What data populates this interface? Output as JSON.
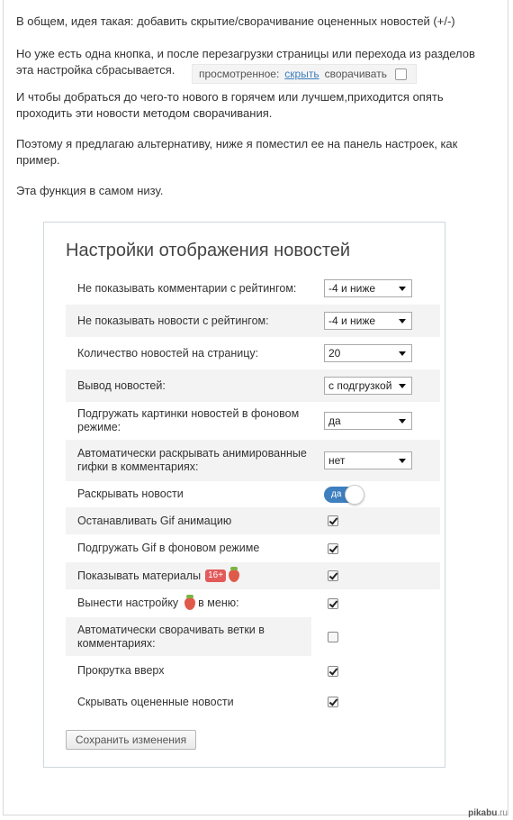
{
  "intro": {
    "p1": "В общем, идея такая: добавить скрытие/сворачивание оцененных новостей (+/-)",
    "p2": "Но уже есть одна кнопка, и после перезагрузки страницы  или перехода из разделов эта настройка сбрасывается.",
    "p3": "И чтобы добраться до чего-то нового в горячем или лучшем,приходится опять проходить эти новости методом сворачивания.",
    "p4": "Поэтому я предлагаю альтернативу, ниже я поместил ее на панель настроек, как пример.",
    "p5": "Эта функция в самом низу."
  },
  "mini_widget": {
    "label": "просмотренное:",
    "link": "скрыть",
    "toggle_label": "сворачивать"
  },
  "panel": {
    "title": "Настройки отображения новостей",
    "rows": {
      "hide_comments": {
        "label": "Не показывать комментарии с рейтингом:",
        "value": "-4 и ниже"
      },
      "hide_news": {
        "label": "Не показывать новости с рейтингом:",
        "value": "-4 и ниже"
      },
      "news_per_page": {
        "label": "Количество новостей на страницу:",
        "value": "20"
      },
      "news_output": {
        "label": "Вывод новостей:",
        "value": "с подгрузкой"
      },
      "bg_images": {
        "label": "Подгружать картинки новостей в фоновом режиме:",
        "value": "да"
      },
      "auto_gif": {
        "label": "Автоматически раскрывать анимированные гифки в комментариях:",
        "value": "нет"
      },
      "expand_news": {
        "label": "Раскрывать новости",
        "toggle": "да"
      },
      "stop_gif": {
        "label": "Останавливать Gif анимацию",
        "checked": true
      },
      "gif_bg": {
        "label": "Подгружать Gif в фоновом режиме",
        "checked": true
      },
      "show_materials": {
        "label": "Показывать материалы",
        "badge": "16+",
        "checked": true
      },
      "menu_setting_pre": {
        "label": "Вынести настройку",
        "label_post": "в меню:",
        "checked": true
      },
      "auto_collapse": {
        "label": "Автоматически сворачивать ветки в комментариях:",
        "checked": false
      },
      "scroll_up": {
        "label": "Прокрутка вверх",
        "checked": true
      },
      "hide_rated": {
        "label": "Скрывать оцененные новости",
        "checked": true
      }
    },
    "save_label": "Сохранить изменения"
  },
  "watermark": {
    "prefix": "pikabu",
    "suffix": ".ru"
  },
  "icons": {
    "strawberry": "strawberry-icon",
    "checkmark": "checkmark-icon",
    "dropdown": "dropdown-arrow-icon"
  },
  "colors": {
    "accent": "#3d7fbf",
    "badge": "#e25a5a"
  }
}
